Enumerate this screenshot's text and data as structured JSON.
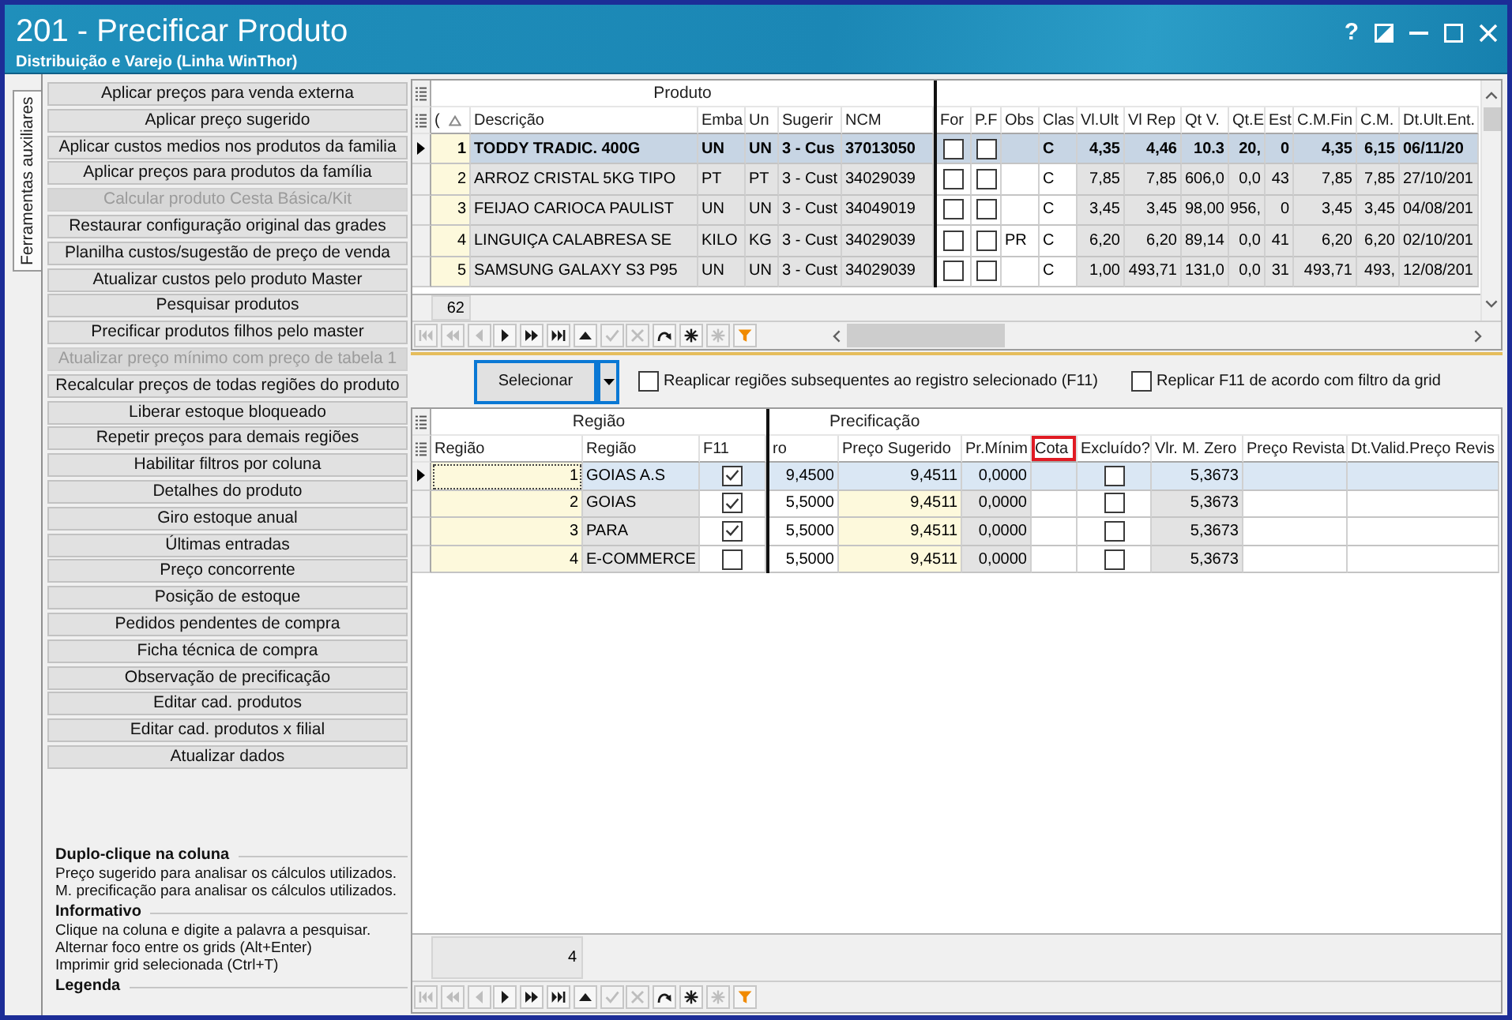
{
  "window": {
    "title": "201 - Precificar Produto",
    "subtitle": "Distribuição e Varejo (Linha WinThor)",
    "help_button": "?"
  },
  "side_tabs": [
    {
      "label": "Ferramentas auxiliares",
      "selected": true
    }
  ],
  "actions": [
    {
      "label": "Aplicar preços para venda externa",
      "disabled": false
    },
    {
      "label": "Aplicar preço sugerido",
      "disabled": false
    },
    {
      "label": "Aplicar custos medios nos produtos da familia",
      "disabled": false
    },
    {
      "label": "Aplicar preços para produtos da família",
      "disabled": false
    },
    {
      "label": "Calcular produto Cesta Básica/Kit",
      "disabled": true
    },
    {
      "label": "Restaurar configuração original das grades",
      "disabled": false
    },
    {
      "label": "Planilha custos/sugestão de preço de venda",
      "disabled": false
    },
    {
      "label": "Atualizar custos pelo produto Master",
      "disabled": false
    },
    {
      "label": "Pesquisar produtos",
      "disabled": false
    },
    {
      "label": "Precificar produtos filhos pelo master",
      "disabled": false
    },
    {
      "label": "Atualizar preço mínimo com preço de tabela 1",
      "disabled": true
    },
    {
      "label": "Recalcular preços de todas regiões do produto",
      "disabled": false
    },
    {
      "label": "Liberar estoque bloqueado",
      "disabled": false
    },
    {
      "label": "Repetir preços para demais regiões",
      "disabled": false
    },
    {
      "label": "Habilitar filtros por coluna",
      "disabled": false
    },
    {
      "label": "Detalhes do produto",
      "disabled": false
    },
    {
      "label": "Giro estoque anual",
      "disabled": false
    },
    {
      "label": "Últimas entradas",
      "disabled": false
    },
    {
      "label": "Preço concorrente",
      "disabled": false
    },
    {
      "label": "Posição de estoque",
      "disabled": false
    },
    {
      "label": "Pedidos pendentes de compra",
      "disabled": false
    },
    {
      "label": "Ficha técnica de compra",
      "disabled": false
    },
    {
      "label": "Observação de precificação",
      "disabled": false
    },
    {
      "label": "Editar cad. produtos",
      "disabled": false
    },
    {
      "label": "Editar cad. produtos x filial",
      "disabled": false
    },
    {
      "label": "Atualizar dados",
      "disabled": false
    }
  ],
  "help": [
    {
      "title": "Duplo-clique na coluna",
      "lines": [
        "Preço sugerido para analisar os cálculos utilizados.",
        "M. precificação para analisar os cálculos utilizados."
      ]
    },
    {
      "title": "Informativo",
      "lines": [
        "Clique na coluna e digite a palavra a pesquisar.",
        "Alternar foco entre os grids (Alt+Enter)",
        "Imprimir grid selecionada (Ctrl+T)"
      ]
    },
    {
      "title": "Legenda"
    }
  ],
  "product_grid": {
    "focused": true,
    "groups": [
      "Produto"
    ],
    "columns": [
      {
        "label": "(",
        "kind": "index",
        "sorted": true
      },
      {
        "label": "Descrição",
        "kind": "readonly_text",
        "sorted": false
      },
      {
        "label": "Emba",
        "kind": "readonly_text",
        "sorted": false
      },
      {
        "label": "Un",
        "kind": "readonly_text",
        "sorted": false
      },
      {
        "label": "Sugerir",
        "kind": "readonly_text",
        "sorted": false
      },
      {
        "label": "NCM",
        "kind": "readonly_text",
        "sorted": false
      },
      {
        "label": "For",
        "kind": "check",
        "sorted": false
      },
      {
        "label": "P.F",
        "kind": "check",
        "sorted": false
      },
      {
        "label": "Obs",
        "kind": "text",
        "sorted": false
      },
      {
        "label": "Clas",
        "kind": "text",
        "sorted": false
      },
      {
        "label": "Vl.Ult",
        "kind": "readonly_number",
        "sorted": false
      },
      {
        "label": "Vl Rep",
        "kind": "readonly_number",
        "sorted": false
      },
      {
        "label": "Qt V.",
        "kind": "readonly_number",
        "sorted": false
      },
      {
        "label": "Qt.E",
        "kind": "readonly_number",
        "sorted": false
      },
      {
        "label": "Est",
        "kind": "readonly_number",
        "sorted": false
      },
      {
        "label": "C.M.Fin",
        "kind": "readonly_number",
        "sorted": false
      },
      {
        "label": "C.M.",
        "kind": "readonly_number",
        "sorted": false
      },
      {
        "label": "Dt.Ult.Ent.",
        "kind": "readonly_text",
        "sorted": false
      }
    ],
    "rows": [
      {
        "selected": true,
        "cells": [
          "1",
          "TODDY TRADIC. 400G",
          "UN",
          "UN",
          "3 - Cus",
          "37013050",
          {
            "checked": false
          },
          {
            "checked": false
          },
          null,
          "C",
          "4,35",
          "4,46",
          "10.3",
          "20,",
          "0",
          "4,35",
          "6,15",
          "06/11/20"
        ]
      },
      {
        "selected": false,
        "cells": [
          "2",
          "ARROZ CRISTAL 5KG TIPO",
          "PT",
          "PT",
          "3 - Cust",
          "34029039",
          {
            "checked": false
          },
          {
            "checked": false
          },
          null,
          "C",
          "7,85",
          "7,85",
          "606,0",
          "0,0",
          "43",
          "7,85",
          "7,85",
          "27/10/201"
        ]
      },
      {
        "selected": false,
        "cells": [
          "3",
          "FEIJAO CARIOCA PAULIST",
          "UN",
          "UN",
          "3 - Cust",
          "34049019",
          {
            "checked": false
          },
          {
            "checked": false
          },
          null,
          "C",
          "3,45",
          "3,45",
          "98,00",
          "956,",
          "0",
          "3,45",
          "3,45",
          "04/08/201"
        ]
      },
      {
        "selected": false,
        "cells": [
          "4",
          "LINGUIÇA CALABRESA SE",
          "KILO",
          "KG",
          "3 - Cust",
          "34029039",
          {
            "checked": false
          },
          {
            "checked": false
          },
          "PR",
          "C",
          "6,20",
          "6,20",
          "89,14",
          "0,0",
          "41",
          "6,20",
          "6,20",
          "02/10/201"
        ]
      },
      {
        "selected": false,
        "cells": [
          "5",
          "SAMSUNG GALAXY S3 P95",
          "UN",
          "UN",
          "3 - Cust",
          "34029039",
          {
            "checked": false
          },
          {
            "checked": false
          },
          null,
          "C",
          "1,00",
          "493,71",
          "131,0",
          "0,0",
          "31",
          "493,71",
          "493,",
          "12/08/201"
        ]
      }
    ],
    "footer": "62",
    "navigator": [
      {
        "kind": "first",
        "disabled": true
      },
      {
        "kind": "prior_page",
        "disabled": true
      },
      {
        "kind": "prior",
        "disabled": true
      },
      {
        "kind": "next",
        "disabled": false
      },
      {
        "kind": "next_page",
        "disabled": false
      },
      {
        "kind": "last",
        "disabled": false
      },
      {
        "kind": "insert",
        "disabled": false
      },
      {
        "kind": "post",
        "disabled": true
      },
      {
        "kind": "cancel",
        "disabled": true
      },
      {
        "kind": "refresh",
        "disabled": false
      },
      {
        "kind": "asterisk",
        "disabled": false
      },
      {
        "kind": "asterisk",
        "disabled": true
      },
      {
        "kind": "filter",
        "disabled": false
      }
    ]
  },
  "toolbar": {
    "select_button": "Selecionar",
    "options": [
      {
        "label": "Reaplicar regiões subsequentes ao registro selecionado (F11)",
        "checked": false
      },
      {
        "label": "Replicar F11 de acordo com filtro da grid",
        "checked": false
      }
    ]
  },
  "region_grid": {
    "focused": false,
    "groups": [
      "Região",
      "Precificação"
    ],
    "columns": [
      {
        "label": "Região",
        "kind": "index",
        "highlighted": false
      },
      {
        "label": "Região",
        "kind": "readonly_text",
        "highlighted": false
      },
      {
        "label": "F11",
        "kind": "check",
        "highlighted": false
      },
      {
        "label": "ro",
        "kind": "number",
        "highlighted": false
      },
      {
        "label": "Preço Sugerido",
        "kind": "suggested_number",
        "highlighted": false
      },
      {
        "label": "Pr.Mínim",
        "kind": "readonly_number",
        "highlighted": false
      },
      {
        "label": "Cota",
        "kind": "number",
        "highlighted": true
      },
      {
        "label": "Excluído?",
        "kind": "check",
        "highlighted": false
      },
      {
        "label": "Vlr. M. Zero",
        "kind": "readonly_number",
        "highlighted": false
      },
      {
        "label": "Preço Revista",
        "kind": "number",
        "highlighted": false
      },
      {
        "label": "Dt.Valid.Preço Revis",
        "kind": "text",
        "highlighted": false
      }
    ],
    "rows": [
      {
        "selected": true,
        "cells": [
          "1",
          "GOIAS A.S",
          {
            "checked": true
          },
          "9,4500",
          "9,4511",
          "0,0000",
          null,
          {
            "checked": false
          },
          "5,3673",
          null,
          null
        ]
      },
      {
        "selected": false,
        "cells": [
          "2",
          "GOIAS",
          {
            "checked": true
          },
          "5,5000",
          "9,4511",
          "0,0000",
          null,
          {
            "checked": false
          },
          "5,3673",
          null,
          null
        ]
      },
      {
        "selected": false,
        "cells": [
          "3",
          "PARA",
          {
            "checked": true
          },
          "5,5000",
          "9,4511",
          "0,0000",
          null,
          {
            "checked": false
          },
          "5,3673",
          null,
          null
        ]
      },
      {
        "selected": false,
        "cells": [
          "4",
          "E-COMMERCE",
          {
            "checked": false
          },
          "5,5000",
          "9,4511",
          "0,0000",
          null,
          {
            "checked": false
          },
          "5,3673",
          null,
          null
        ]
      }
    ],
    "footer": "4",
    "navigator": [
      {
        "kind": "first",
        "disabled": true
      },
      {
        "kind": "prior_page",
        "disabled": true
      },
      {
        "kind": "prior",
        "disabled": true
      },
      {
        "kind": "next",
        "disabled": false
      },
      {
        "kind": "next_page",
        "disabled": false
      },
      {
        "kind": "last",
        "disabled": false
      },
      {
        "kind": "insert",
        "disabled": false
      },
      {
        "kind": "post",
        "disabled": true
      },
      {
        "kind": "cancel",
        "disabled": true
      },
      {
        "kind": "refresh",
        "disabled": false
      },
      {
        "kind": "asterisk",
        "disabled": false
      },
      {
        "kind": "asterisk",
        "disabled": true
      },
      {
        "kind": "filter",
        "disabled": false
      }
    ]
  }
}
